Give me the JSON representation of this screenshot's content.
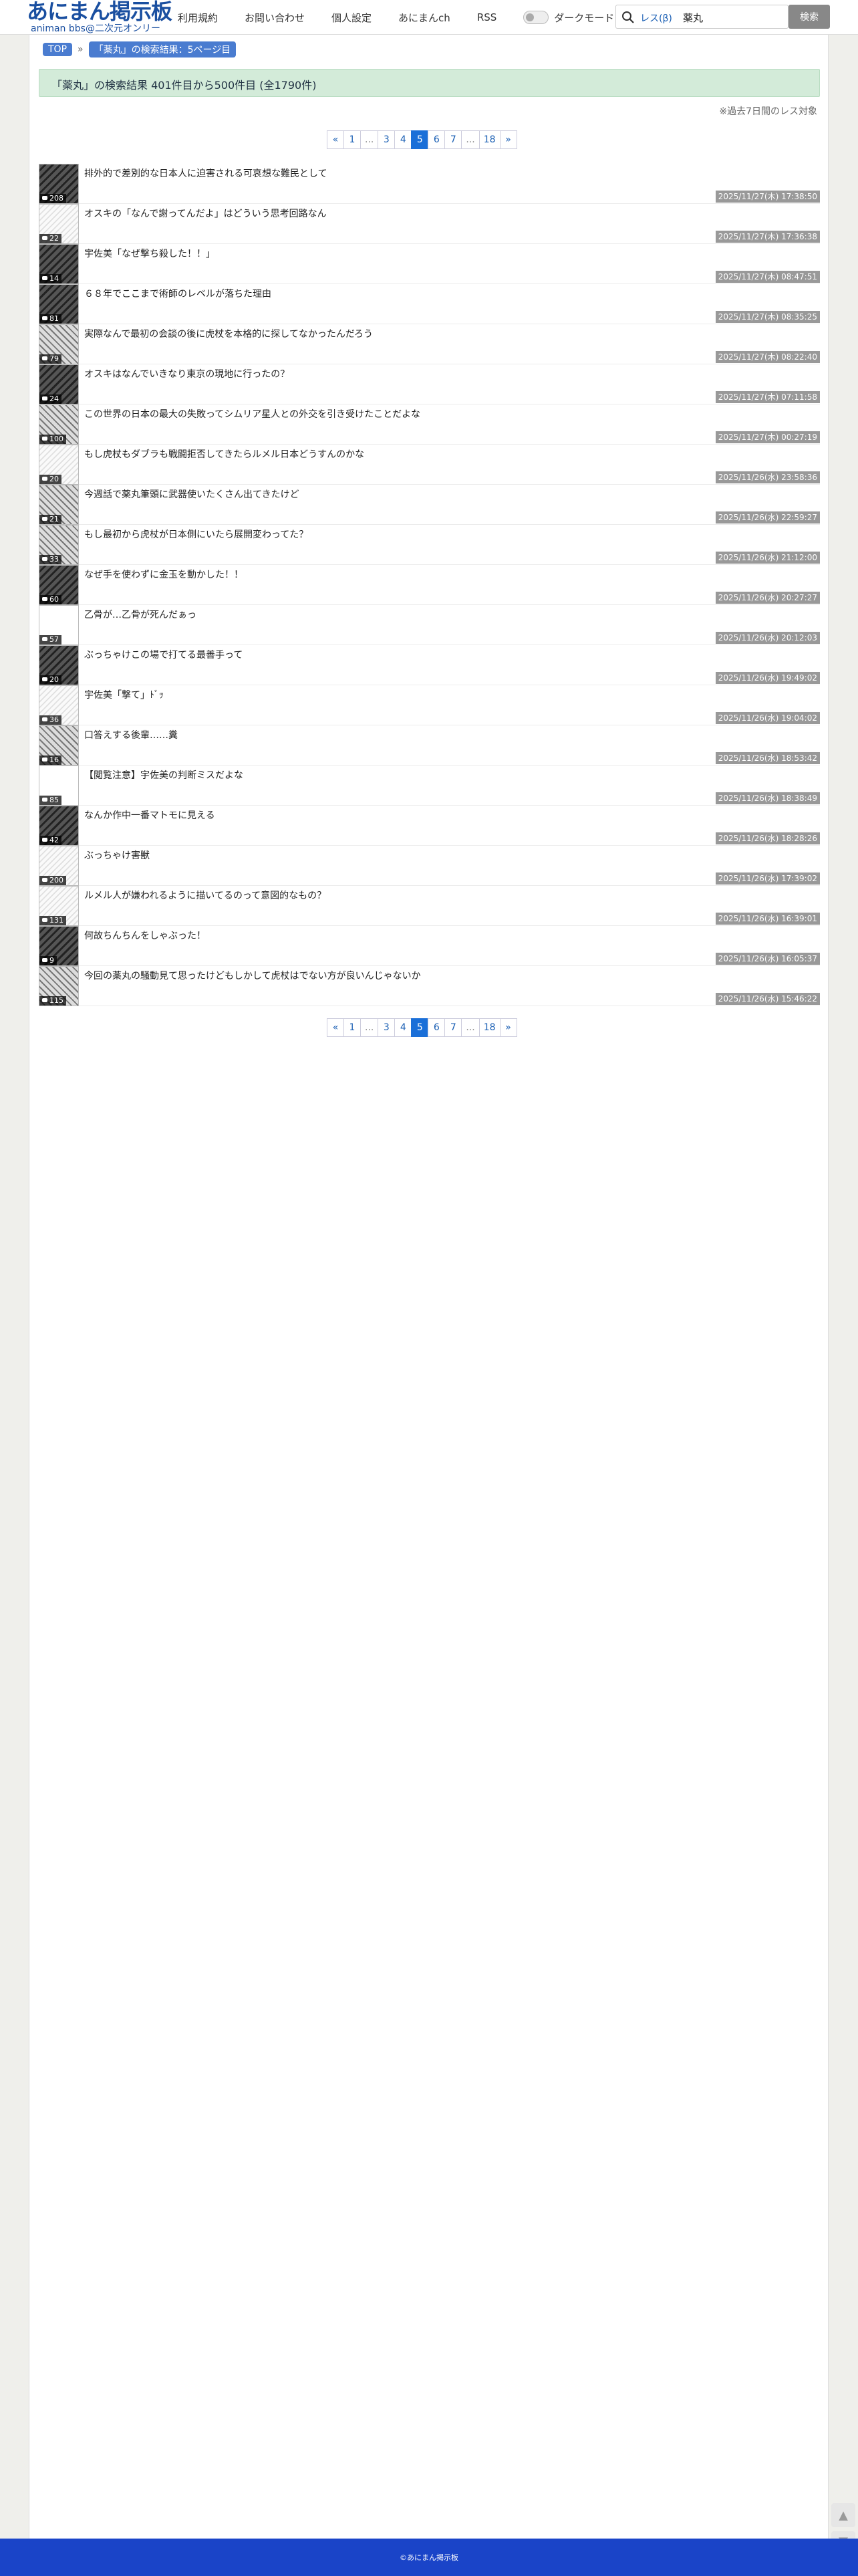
{
  "header": {
    "logo_main": "あにまん掲示板",
    "logo_sub": "animan bbs@二次元オンリー",
    "nav": [
      "利用規約",
      "お問い合わせ",
      "個人設定",
      "あにまんch",
      "RSS"
    ],
    "dark_mode_label": "ダークモード",
    "search_type": "レス(β)",
    "search_value": "薬丸",
    "search_button": "検索"
  },
  "breadcrumb": {
    "top": "TOP",
    "current": "「薬丸」の検索結果：5ページ目"
  },
  "result_summary": "「薬丸」の検索結果 401件目から500件目 (全1790件)",
  "note": "※過去7日間のレス対象",
  "pagination": {
    "prev": "«",
    "next": "»",
    "pages": [
      "1",
      "...",
      "3",
      "4",
      "5",
      "6",
      "7",
      "...",
      "18"
    ],
    "active": "5"
  },
  "threads": [
    {
      "title": "排外的で差別的な日本人に迫害される可哀想な難民として",
      "count": "208",
      "date": "2025/11/27(木) 17:38:50",
      "thumb": "dark"
    },
    {
      "title": "オスキの「なんで謝ってんだよ」はどういう思考回路なん",
      "count": "22",
      "date": "2025/11/27(木) 17:36:38",
      "thumb": "light"
    },
    {
      "title": "宇佐美「なぜ撃ち殺した！！」",
      "count": "14",
      "date": "2025/11/27(木) 08:47:51",
      "thumb": "dark"
    },
    {
      "title": "６８年でここまで術師のレベルが落ちた理由",
      "count": "81",
      "date": "2025/11/27(木) 08:35:25",
      "thumb": "dark"
    },
    {
      "title": "実際なんで最初の会談の後に虎杖を本格的に探してなかったんだろう",
      "count": "79",
      "date": "2025/11/27(木) 08:22:40",
      "thumb": "mid"
    },
    {
      "title": "オスキはなんでいきなり東京の現地に行ったの？",
      "count": "24",
      "date": "2025/11/27(木) 07:11:58",
      "thumb": "dark"
    },
    {
      "title": "この世界の日本の最大の失敗ってシムリア星人との外交を引き受けたことだよな",
      "count": "100",
      "date": "2025/11/27(木) 00:27:19",
      "thumb": "mid"
    },
    {
      "title": "もし虎杖もダブラも戦闘拒否してきたらルメル日本どうすんのかな",
      "count": "20",
      "date": "2025/11/26(水) 23:58:36",
      "thumb": "light"
    },
    {
      "title": "今週話で薬丸筆頭に武器使いたくさん出てきたけど",
      "count": "21",
      "date": "2025/11/26(水) 22:59:27",
      "thumb": "mid"
    },
    {
      "title": "もし最初から虎杖が日本側にいたら展開変わってた？",
      "count": "33",
      "date": "2025/11/26(水) 21:12:00",
      "thumb": "mid"
    },
    {
      "title": "なぜ手を使わずに金玉を動かした！！",
      "count": "60",
      "date": "2025/11/26(水) 20:27:27",
      "thumb": "dark"
    },
    {
      "title": "乙骨が…乙骨が死んだぁっ",
      "count": "57",
      "date": "2025/11/26(水) 20:12:03",
      "thumb": "white"
    },
    {
      "title": "ぶっちゃけこの場で打てる最善手って",
      "count": "20",
      "date": "2025/11/26(水) 19:49:02",
      "thumb": "dark"
    },
    {
      "title": "宇佐美「撃て」ﾄﾞｯ",
      "count": "36",
      "date": "2025/11/26(水) 19:04:02",
      "thumb": "light"
    },
    {
      "title": "口答えする後輩……糞",
      "count": "16",
      "date": "2025/11/26(水) 18:53:42",
      "thumb": "mid"
    },
    {
      "title": "【閲覧注意】宇佐美の判断ミスだよな",
      "count": "85",
      "date": "2025/11/26(水) 18:38:49",
      "thumb": "white"
    },
    {
      "title": "なんか作中一番マトモに見える",
      "count": "42",
      "date": "2025/11/26(水) 18:28:26",
      "thumb": "dark"
    },
    {
      "title": "ぶっちゃけ害獣",
      "count": "200",
      "date": "2025/11/26(水) 17:39:02",
      "thumb": "light"
    },
    {
      "title": "ルメル人が嫌われるように描いてるのって意図的なもの？",
      "count": "131",
      "date": "2025/11/26(水) 16:39:01",
      "thumb": "light"
    },
    {
      "title": "何故ちんちんをしゃぶった！",
      "count": "9",
      "date": "2025/11/26(水) 16:05:37",
      "thumb": "dark"
    },
    {
      "title": "今回の薬丸の騒動見て思ったけどもしかして虎杖はでない方が良いんじゃないか",
      "count": "115",
      "date": "2025/11/26(水) 15:46:22",
      "thumb": "mid"
    }
  ],
  "footer": "©あにまん掲示板"
}
